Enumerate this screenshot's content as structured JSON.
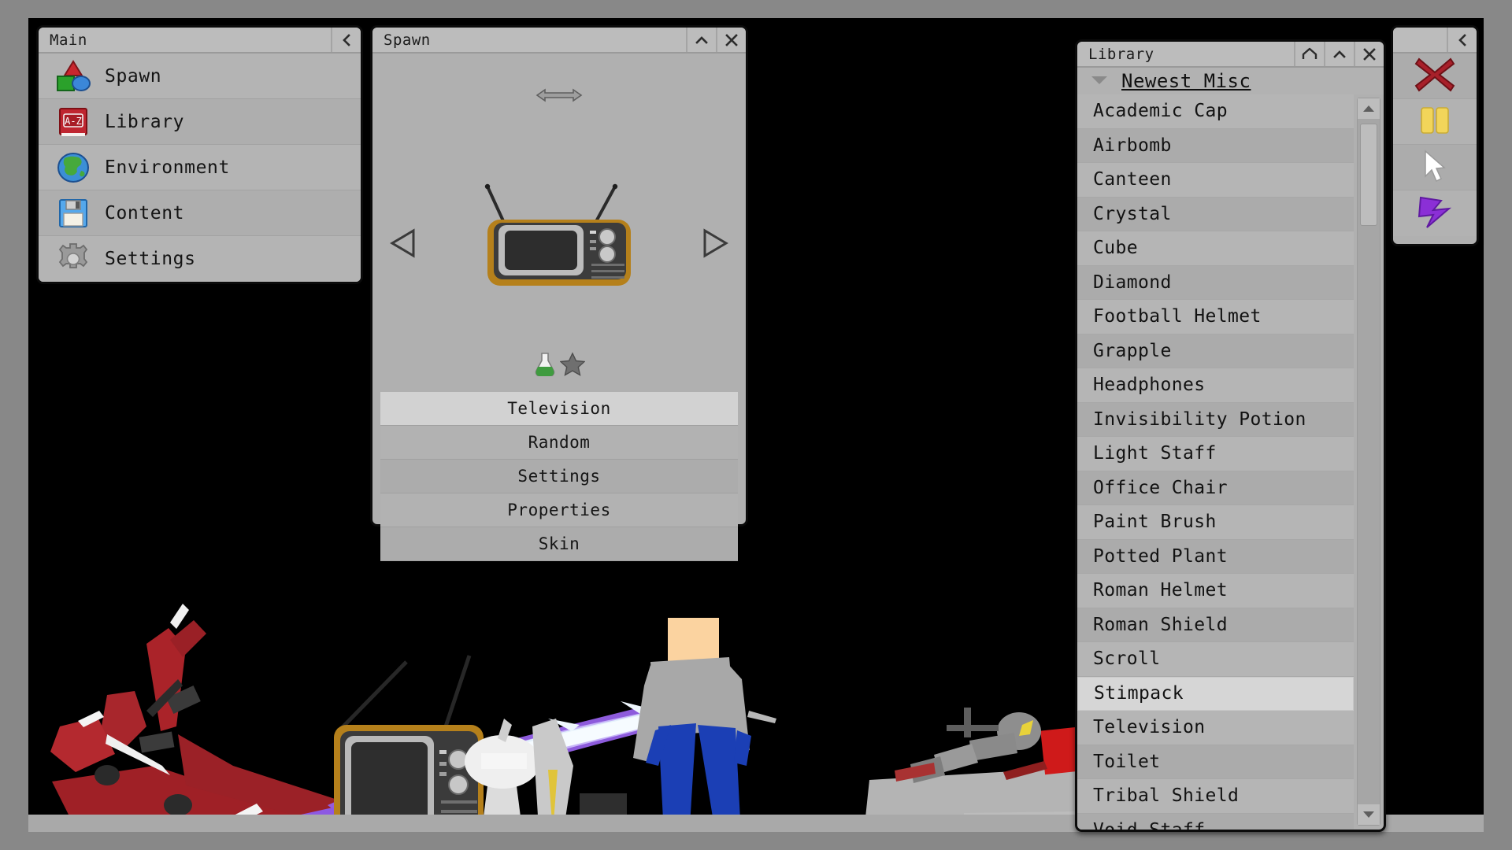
{
  "app": {
    "viewport_bg": "#000000",
    "frame_bg": "#888888",
    "panel_bg": "#b0b0b0",
    "accent_selected": "#d4d4d4"
  },
  "main_panel": {
    "title": "Main",
    "collapse_icon": "chevron-left-icon",
    "items": [
      {
        "label": "Spawn",
        "icon": "shapes-icon"
      },
      {
        "label": "Library",
        "icon": "book-az-icon"
      },
      {
        "label": "Environment",
        "icon": "globe-icon"
      },
      {
        "label": "Content",
        "icon": "floppy-disk-icon"
      },
      {
        "label": "Settings",
        "icon": "gear-icon"
      }
    ]
  },
  "spawn_panel": {
    "title": "Spawn",
    "minimize_icon": "chevron-up-icon",
    "close_icon": "close-icon",
    "resize_icon": "horizontal-resize-arrows-icon",
    "prev_icon": "triangle-left-icon",
    "next_icon": "triangle-right-icon",
    "preview_item": "television-preview",
    "badges": [
      {
        "name": "flask-icon",
        "color": "#3f9b3f"
      },
      {
        "name": "star-icon",
        "color": "#6f6f6f"
      }
    ],
    "buttons": [
      {
        "label": "Television",
        "selected": true
      },
      {
        "label": "Random",
        "selected": false
      },
      {
        "label": "Settings",
        "selected": false
      },
      {
        "label": "Properties",
        "selected": false
      },
      {
        "label": "Skin",
        "selected": false
      }
    ]
  },
  "library_panel": {
    "title": "Library",
    "home_icon": "home-icon",
    "minimize_icon": "chevron-up-icon",
    "close_icon": "close-icon",
    "category": {
      "label": "Newest Misc",
      "expanded": true,
      "caret_icon": "caret-down-icon"
    },
    "scrollbar": {
      "up_icon": "scroll-up-arrow-icon",
      "down_icon": "scroll-down-arrow-icon"
    },
    "items": [
      {
        "label": "Academic Cap",
        "selected": false
      },
      {
        "label": "Airbomb",
        "selected": false
      },
      {
        "label": "Canteen",
        "selected": false
      },
      {
        "label": "Crystal",
        "selected": false
      },
      {
        "label": "Cube",
        "selected": false
      },
      {
        "label": "Diamond",
        "selected": false
      },
      {
        "label": "Football Helmet",
        "selected": false
      },
      {
        "label": "Grapple",
        "selected": false
      },
      {
        "label": "Headphones",
        "selected": false
      },
      {
        "label": "Invisibility Potion",
        "selected": false
      },
      {
        "label": "Light Staff",
        "selected": false
      },
      {
        "label": "Office Chair",
        "selected": false
      },
      {
        "label": "Paint Brush",
        "selected": false
      },
      {
        "label": "Potted Plant",
        "selected": false
      },
      {
        "label": "Roman Helmet",
        "selected": false
      },
      {
        "label": "Roman Shield",
        "selected": false
      },
      {
        "label": "Scroll",
        "selected": false
      },
      {
        "label": "Stimpack",
        "selected": true
      },
      {
        "label": "Television",
        "selected": false
      },
      {
        "label": "Toilet",
        "selected": false
      },
      {
        "label": "Tribal Shield",
        "selected": false
      },
      {
        "label": "Void Staff",
        "selected": false
      }
    ]
  },
  "tool_panel": {
    "collapse_icon": "chevron-left-icon",
    "tools": [
      {
        "name": "delete-tool",
        "icon": "red-x-icon",
        "color": "#a8202a"
      },
      {
        "name": "pause-tool",
        "icon": "yellow-pause-icon",
        "color": "#f2d55a"
      },
      {
        "name": "select-tool",
        "icon": "white-cursor-icon",
        "color": "#ffffff"
      },
      {
        "name": "lightning-tool",
        "icon": "purple-lightning-icon",
        "color": "#8b2fd6"
      }
    ]
  },
  "scene": {
    "ground_color": "#a9a9a9",
    "objects": [
      {
        "name": "red-mech-rig",
        "color": "#b3282d"
      },
      {
        "name": "light-staff",
        "color": "#c9b6f7"
      },
      {
        "name": "television",
        "color": "#b5801b"
      },
      {
        "name": "desk-fan",
        "color": "#e8e8e8"
      },
      {
        "name": "ragdoll-character",
        "head": "#fbd3a0",
        "torso": "#a8a8a8",
        "legs": "#1b3fb5"
      },
      {
        "name": "grey-slab",
        "color": "#b4b4b4"
      },
      {
        "name": "red-book",
        "color": "#cf1a1a"
      },
      {
        "name": "robot-arm",
        "color": "#8e8e8e"
      }
    ]
  }
}
